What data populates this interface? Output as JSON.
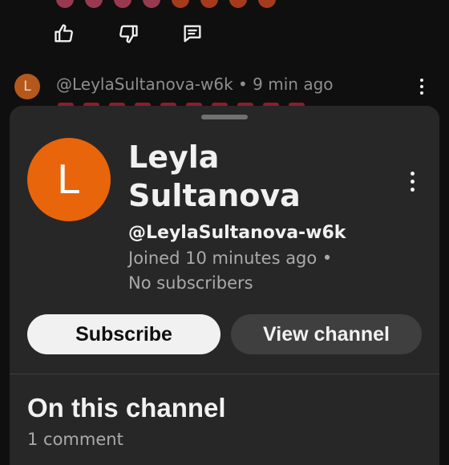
{
  "comment": {
    "avatar_letter": "L",
    "author": "@LeylaSultanova-w6k",
    "separator": "•",
    "time": "9 min ago",
    "actions": [
      "like-icon",
      "dislike-icon",
      "reply-icon"
    ]
  },
  "channel_sheet": {
    "avatar_letter": "L",
    "name": "Leyla Sultanova",
    "handle": "@LeylaSultanova-w6k",
    "joined": "Joined 10 minutes ago •",
    "subscribers": "No subscribers",
    "subscribe_label": "Subscribe",
    "view_channel_label": "View channel",
    "section_title": "On this channel",
    "section_count": "1 comment"
  },
  "colors": {
    "background": "#0f0f0f",
    "sheet": "#272727",
    "avatar": "#e8650b",
    "subscribe_bg": "#f1f1f1",
    "view_channel_bg": "#3f3f3f"
  }
}
